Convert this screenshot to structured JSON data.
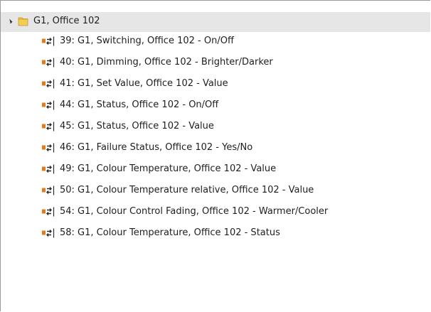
{
  "tree": {
    "root": {
      "label": "G1, Office 102",
      "expanded": true,
      "icon": "folder-icon"
    },
    "items": [
      {
        "label": "39: G1, Switching, Office 102 - On/Off"
      },
      {
        "label": "40: G1, Dimming, Office 102 - Brighter/Darker"
      },
      {
        "label": "41: G1, Set Value, Office 102 - Value"
      },
      {
        "label": "44: G1, Status, Office 102 - On/Off"
      },
      {
        "label": "45: G1, Status, Office 102 - Value"
      },
      {
        "label": "46: G1, Failure Status, Office 102 - Yes/No"
      },
      {
        "label": "49: G1, Colour Temperature, Office 102 - Value"
      },
      {
        "label": "50: G1, Colour Temperature relative, Office 102 - Value"
      },
      {
        "label": "54: G1, Colour Control Fading, Office 102 - Warmer/Cooler"
      },
      {
        "label": "58: G1, Colour Temperature, Office 102 - Status"
      }
    ]
  },
  "colors": {
    "selected_row": "#e6e6e6",
    "folder": "#e8b83a",
    "object_icon_orange": "#e07b20",
    "object_icon_dark": "#2b2b2b"
  }
}
